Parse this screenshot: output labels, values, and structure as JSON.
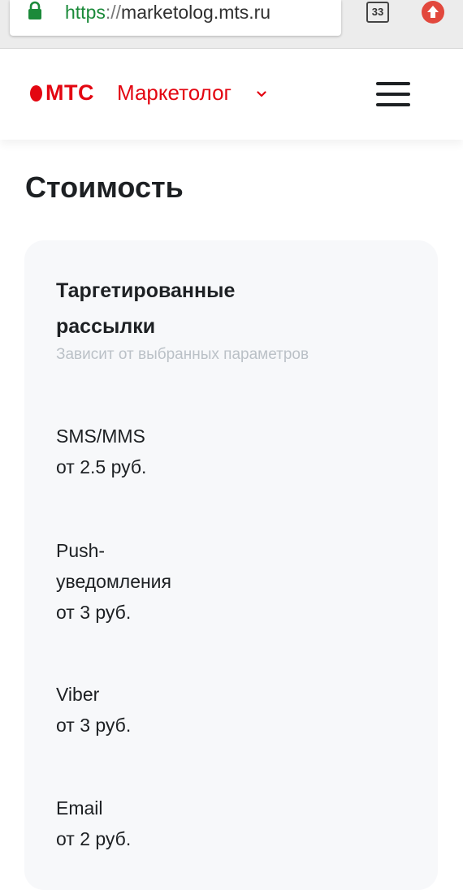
{
  "browser": {
    "url_scheme": "https",
    "url_separator": "://",
    "url_host": "marketolog.mts.ru",
    "tab_count": "33",
    "icons": [
      "lock-icon",
      "tabs-icon",
      "update-icon"
    ]
  },
  "header": {
    "logo_text": "МТС",
    "product_name": "Маркетолог",
    "icons": [
      "mts-egg-icon",
      "chevron-down-icon",
      "menu-icon"
    ],
    "brand_color": "#e30611"
  },
  "main": {
    "title": "Стоимость",
    "card": {
      "title": "Таргетированные рассылки",
      "subtitle": "Зависит от выбранных параметров",
      "items": [
        {
          "name": "SMS/MMS",
          "price": "от 2.5 руб."
        },
        {
          "name": "Push-уведомления",
          "price": "от 3 руб."
        },
        {
          "name": "Viber",
          "price": "от 3 руб."
        },
        {
          "name": "Email",
          "price": "от 2 руб."
        }
      ]
    }
  }
}
